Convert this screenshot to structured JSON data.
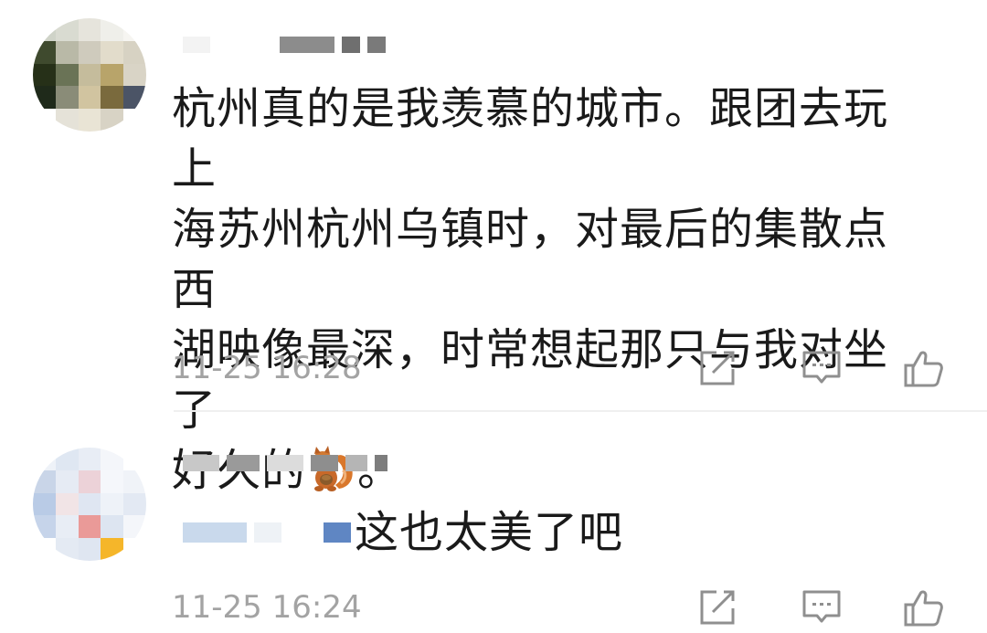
{
  "comments": [
    {
      "text_line1": "杭州真的是我羡慕的城市。跟团去玩上",
      "text_line2": "海苏州杭州乌镇时，对最后的集散点西",
      "text_line3": "湖映像最深，时常想起那只与我对坐了",
      "text_line4_prefix": "好久的",
      "text_line4_suffix": "。",
      "emoji": "squirrel-emoji",
      "time": "11-25 16:28"
    },
    {
      "text": "这也太美了吧",
      "time": "11-25 16:24"
    }
  ],
  "icons": {
    "repost": "share-edit-icon",
    "comment": "comment-icon",
    "like": "thumbs-up-icon"
  },
  "colors": {
    "text": "#1a1a1a",
    "meta": "#a3a3a3",
    "icon": "#8f8f8f"
  }
}
